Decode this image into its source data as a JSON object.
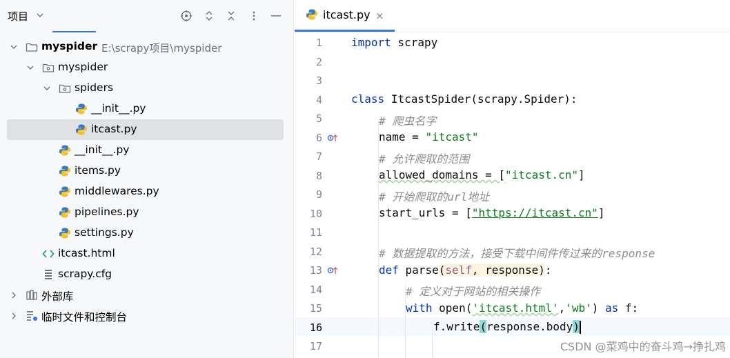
{
  "project_panel": {
    "title": "项目",
    "tree": [
      {
        "label": "myspider",
        "path": "E:\\scrapy项目\\myspider",
        "level": 0,
        "icon": "folder-icon",
        "expanded": true
      },
      {
        "label": "myspider",
        "level": 1,
        "icon": "package-icon",
        "expanded": true
      },
      {
        "label": "spiders",
        "level": 2,
        "icon": "package-icon",
        "expanded": true
      },
      {
        "label": "__init__.py",
        "level": 3,
        "icon": "python-icon"
      },
      {
        "label": "itcast.py",
        "level": 3,
        "icon": "python-icon",
        "selected": true
      },
      {
        "label": "__init__.py",
        "level": 2,
        "icon": "python-icon"
      },
      {
        "label": "items.py",
        "level": 2,
        "icon": "python-icon"
      },
      {
        "label": "middlewares.py",
        "level": 2,
        "icon": "python-icon"
      },
      {
        "label": "pipelines.py",
        "level": 2,
        "icon": "python-icon"
      },
      {
        "label": "settings.py",
        "level": 2,
        "icon": "python-icon"
      },
      {
        "label": "itcast.html",
        "level": 1,
        "icon": "html-icon"
      },
      {
        "label": "scrapy.cfg",
        "level": 1,
        "icon": "config-file-icon"
      },
      {
        "label": "外部库",
        "level": 0,
        "icon": "library-icon",
        "expanded": false
      },
      {
        "label": "临时文件和控制台",
        "level": 0,
        "icon": "scratches-icon",
        "expanded": false
      }
    ]
  },
  "editor": {
    "tab": {
      "label": "itcast.py",
      "close": "×"
    },
    "line_numbers": [
      "1",
      "2",
      "3",
      "4",
      "5",
      "6",
      "7",
      "8",
      "9",
      "10",
      "11",
      "12",
      "13",
      "14",
      "15",
      "16",
      "17"
    ],
    "current_line": "16",
    "lines": {
      "l1": {
        "kw": "import",
        "rest": " scrapy"
      },
      "l4": {
        "kw": "class",
        "rest": " ItcastSpider(scrapy.Spider):"
      },
      "l5": {
        "comment": "# 爬虫名字"
      },
      "l6": {
        "pre": "name = ",
        "str": "\"itcast\""
      },
      "l7": {
        "comment": "# 允许爬取的范围"
      },
      "l8": {
        "pre": "allowed_domains = [",
        "str": "\"itcast.cn\"",
        "post": "]"
      },
      "l9": {
        "comment": "# 开始爬取的url地址"
      },
      "l10": {
        "pre": "start_urls = [",
        "str": "\"https://itcast.cn\"",
        "post": "]"
      },
      "l12": {
        "comment": "# 数据提取的方法，接受下载中间件传过来的response"
      },
      "l13": {
        "kw": "def",
        "name": " parse",
        "open": "(",
        "self": "self",
        "rest": ", response",
        "close": ")",
        "end": ":"
      },
      "l14": {
        "comment": "# 定义对于网站的相关操作"
      },
      "l15": {
        "kw": "with",
        "pre": " open(",
        "s1": "'itcast.html'",
        "comma": ",",
        "s2": "'wb'",
        "post": ") ",
        "kw2": "as",
        "end": " f:"
      },
      "l16": {
        "pre": "f.write",
        "open": "(",
        "mid": "response.body",
        "close": ")"
      }
    }
  },
  "watermark": "CSDN @菜鸡中的奋斗鸡→挣扎鸡",
  "colors": {
    "accent": "#3574f0",
    "keyword": "#0033b3",
    "string": "#067d17",
    "comment": "#8c8c8c",
    "self": "#94558d"
  }
}
